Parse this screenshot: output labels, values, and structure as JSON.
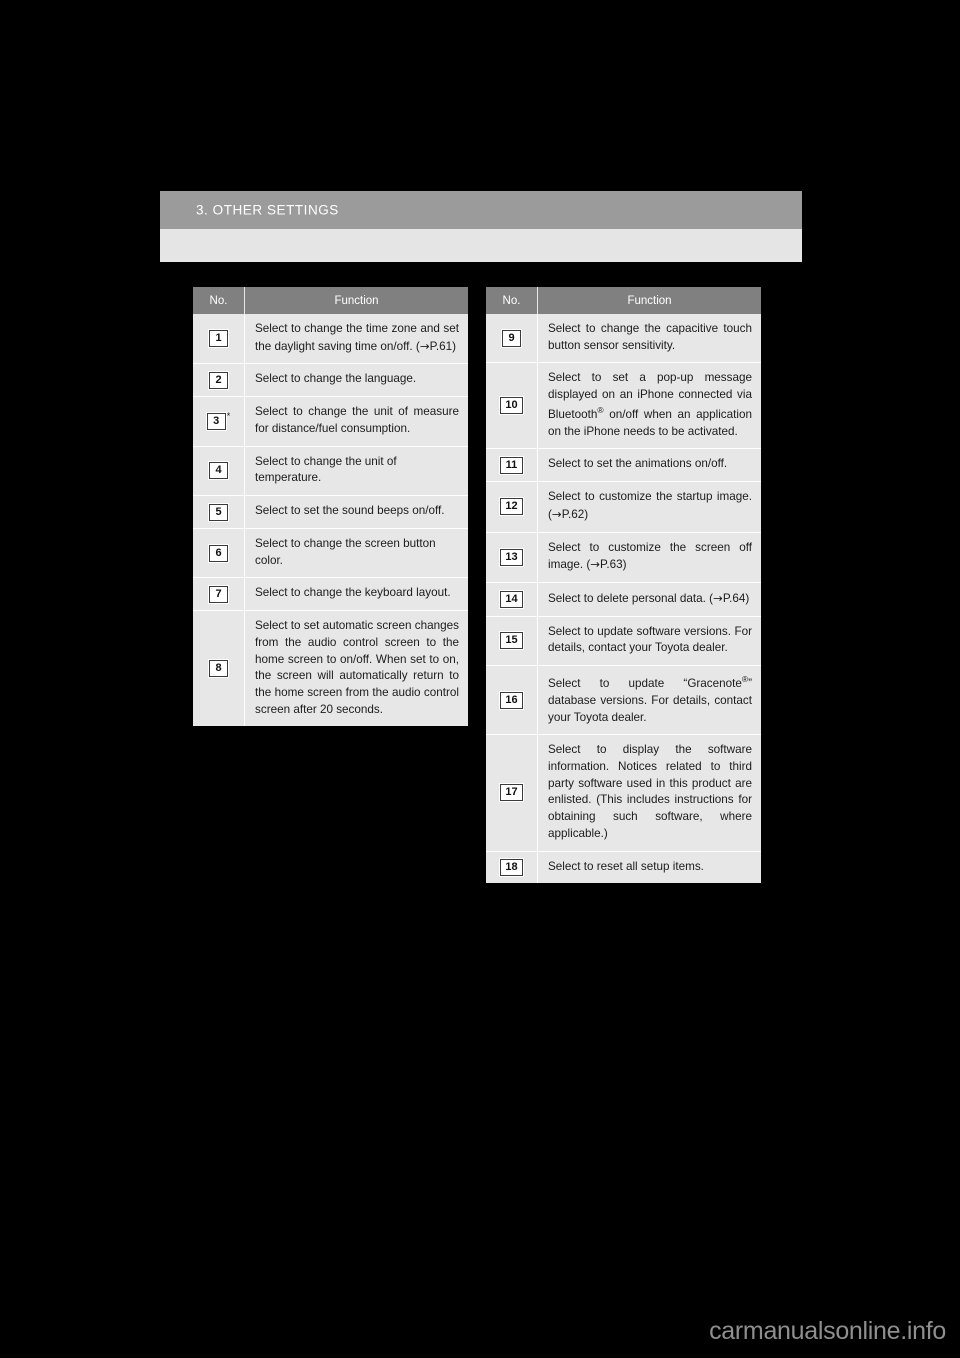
{
  "page": {
    "section_title": "3. OTHER SETTINGS",
    "watermark": "carmanualsonline.info"
  },
  "tables": {
    "left": {
      "headers": {
        "no": "No.",
        "function": "Function"
      },
      "rows": [
        {
          "no": "1",
          "marker": "",
          "function": "Select to change the time zone and set the daylight saving time on/off. (→P.61)"
        },
        {
          "no": "2",
          "marker": "",
          "function": "Select to change the language."
        },
        {
          "no": "3",
          "marker": "*",
          "function": "Select to change the unit of measure for distance/fuel consumption."
        },
        {
          "no": "4",
          "marker": "",
          "function": "Select to change the unit of temperature."
        },
        {
          "no": "5",
          "marker": "",
          "function": "Select to set the sound beeps on/off."
        },
        {
          "no": "6",
          "marker": "",
          "function": "Select to change the screen button color."
        },
        {
          "no": "7",
          "marker": "",
          "function": "Select to change the keyboard layout."
        },
        {
          "no": "8",
          "marker": "",
          "function": "Select to set automatic screen changes from the audio control screen to the home screen to on/off. When set to on, the screen will automatically return to the home screen from the audio control screen after 20 seconds."
        }
      ]
    },
    "right": {
      "headers": {
        "no": "No.",
        "function": "Function"
      },
      "rows": [
        {
          "no": "9",
          "marker": "",
          "function": "Select to change the capacitive touch button sensor sensitivity."
        },
        {
          "no": "10",
          "marker": "",
          "function": "Select to set a pop-up message displayed on an iPhone connected via Bluetooth® on/off when an application on the iPhone needs to be activated."
        },
        {
          "no": "11",
          "marker": "",
          "function": "Select to set the animations on/off."
        },
        {
          "no": "12",
          "marker": "",
          "function": "Select to customize the startup image. (→P.62)"
        },
        {
          "no": "13",
          "marker": "",
          "function": "Select to customize the screen off image. (→P.63)"
        },
        {
          "no": "14",
          "marker": "",
          "function": "Select to delete personal data. (→P.64)"
        },
        {
          "no": "15",
          "marker": "",
          "function": "Select to update software versions. For details, contact your Toyota dealer."
        },
        {
          "no": "16",
          "marker": "",
          "function": "Select to update “Gracenote®” database versions. For details, contact your Toyota dealer."
        },
        {
          "no": "17",
          "marker": "",
          "function": "Select to display the software information. Notices related to third party software used in this product are enlisted. (This includes instructions for obtaining such software, where applicable.)"
        },
        {
          "no": "18",
          "marker": "",
          "function": "Select to reset all setup items."
        }
      ]
    }
  }
}
